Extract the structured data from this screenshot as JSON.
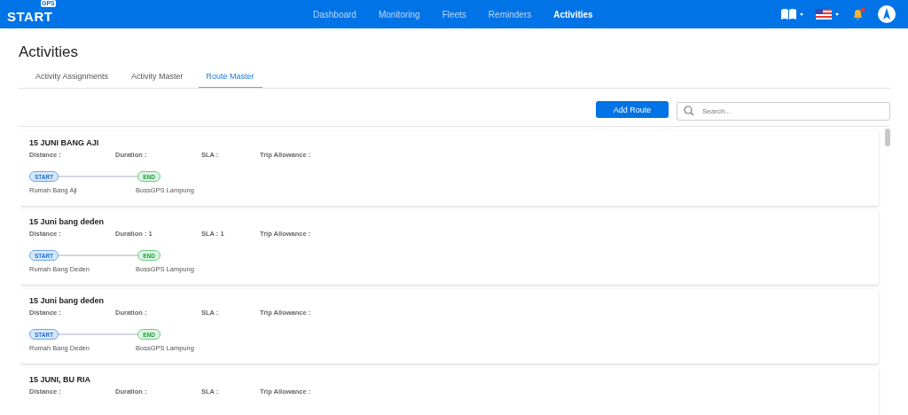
{
  "logo": {
    "text": "START",
    "badge": "GPS"
  },
  "nav": [
    {
      "label": "Dashboard",
      "selected": false
    },
    {
      "label": "Monitoring",
      "selected": false
    },
    {
      "label": "Fleets",
      "selected": false
    },
    {
      "label": "Reminders",
      "selected": false
    },
    {
      "label": "Activities",
      "selected": true
    }
  ],
  "notification_dot": true,
  "page_title": "Activities",
  "tabs": [
    {
      "label": "Activity Assignments",
      "selected": false
    },
    {
      "label": "Activity Master",
      "selected": false
    },
    {
      "label": "Route Master",
      "selected": true
    }
  ],
  "add_button": "Add Route",
  "search": {
    "placeholder": "Search..."
  },
  "routes": [
    {
      "name": "15 JUNI BANG AJI",
      "distance": "Distance :",
      "duration": "Duration :",
      "sla": "SLA :",
      "allowance": "Trip Allowance :",
      "start_tag": "START",
      "end_tag": "END",
      "start": "Rumah Bang Aji",
      "end": "BossGPS Lampung"
    },
    {
      "name": "15 Juni bang deden",
      "distance": "Distance :",
      "duration": "Duration : 1",
      "sla": "SLA : 1",
      "allowance": "Trip Allowance :",
      "start_tag": "START",
      "end_tag": "END",
      "start": "Rumah Bang Deden",
      "end": "BossGPS Lampung"
    },
    {
      "name": "15 Juni bang deden",
      "distance": "Distance :",
      "duration": "Duration :",
      "sla": "SLA :",
      "allowance": "Trip Allowance :",
      "start_tag": "START",
      "end_tag": "END",
      "start": "Rumah Bang Deden",
      "end": "BossGPS Lampung"
    },
    {
      "name": "15 JUNI, BU RIA",
      "distance": "Distance :",
      "duration": "Duration :",
      "sla": "SLA :",
      "allowance": "Trip Allowance :"
    }
  ]
}
